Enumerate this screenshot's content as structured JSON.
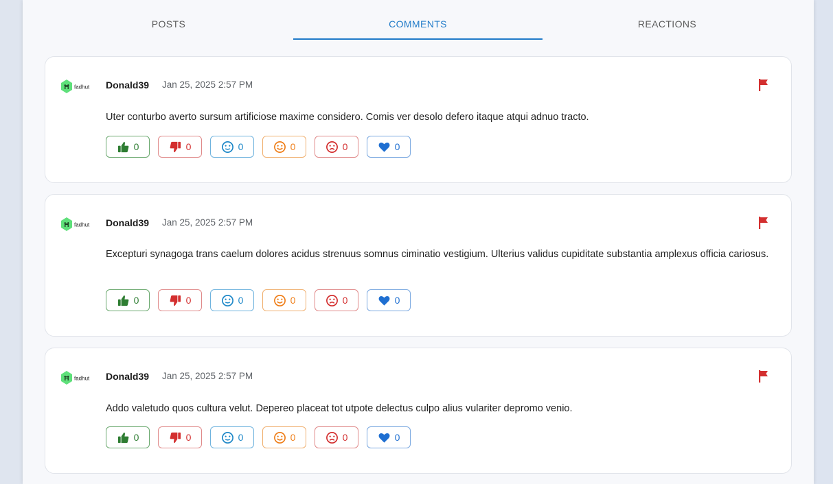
{
  "tabs": [
    {
      "label": "POSTS"
    },
    {
      "label": "COMMENTS"
    },
    {
      "label": "REACTIONS"
    }
  ],
  "active_tab": "COMMENTS",
  "comments": [
    {
      "author": "Donald39",
      "timestamp": "Jan 25, 2025 2:57 PM",
      "text": "Uter conturbo averto sursum artificiose maxime considero. Comis ver desolo defero itaque atqui adnuo tracto.",
      "reactions": {
        "like": "0",
        "dislike": "0",
        "neutral": "0",
        "happy": "0",
        "sad": "0",
        "love": "0"
      }
    },
    {
      "author": "Donald39",
      "timestamp": "Jan 25, 2025 2:57 PM",
      "text": "Excepturi synagoga trans caelum dolores acidus strenuus somnus ciminatio vestigium. Ulterius validus cupiditate substantia amplexus officia cariosus.",
      "reactions": {
        "like": "0",
        "dislike": "0",
        "neutral": "0",
        "happy": "0",
        "sad": "0",
        "love": "0"
      }
    },
    {
      "author": "Donald39",
      "timestamp": "Jan 25, 2025 2:57 PM",
      "text": "Addo valetudo quos cultura velut. Depereo placeat tot utpote delectus culpo alius vulariter depromo venio.",
      "reactions": {
        "like": "0",
        "dislike": "0",
        "neutral": "0",
        "happy": "0",
        "sad": "0",
        "love": "0"
      }
    }
  ],
  "logo": {
    "text": "fadhut"
  },
  "icons": {
    "flag": "flag-icon",
    "like": "thumbs-up-icon",
    "dislike": "thumbs-down-icon",
    "neutral": "neutral-face-icon",
    "happy": "smile-face-icon",
    "sad": "sad-face-icon",
    "love": "heart-icon"
  },
  "colors": {
    "accent": "#1f7ac8",
    "flag": "#d32f2f",
    "like": "#2e7d32",
    "dislike": "#d32f2f",
    "neutral": "#1e88c8",
    "happy": "#ef7f1a",
    "sad": "#d32f2f",
    "love": "#1f6fd1",
    "logo": "#5ee07a"
  }
}
